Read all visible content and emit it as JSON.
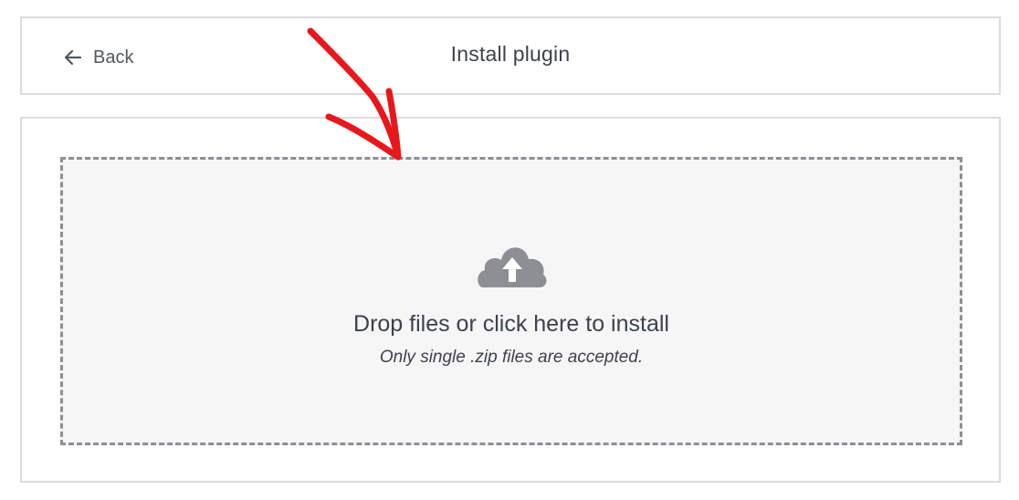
{
  "header": {
    "back_label": "Back",
    "title": "Install plugin"
  },
  "dropzone": {
    "title": "Drop files or click here to install",
    "hint": "Only single .zip files are accepted."
  },
  "icons": {
    "back": "arrow-left-icon",
    "upload": "cloud-upload-icon",
    "annotation": "red-arrow-annotation"
  },
  "colors": {
    "annotation": "#e8171b",
    "icon": "#8c8f94",
    "dropzone_bg": "#f6f6f7"
  }
}
